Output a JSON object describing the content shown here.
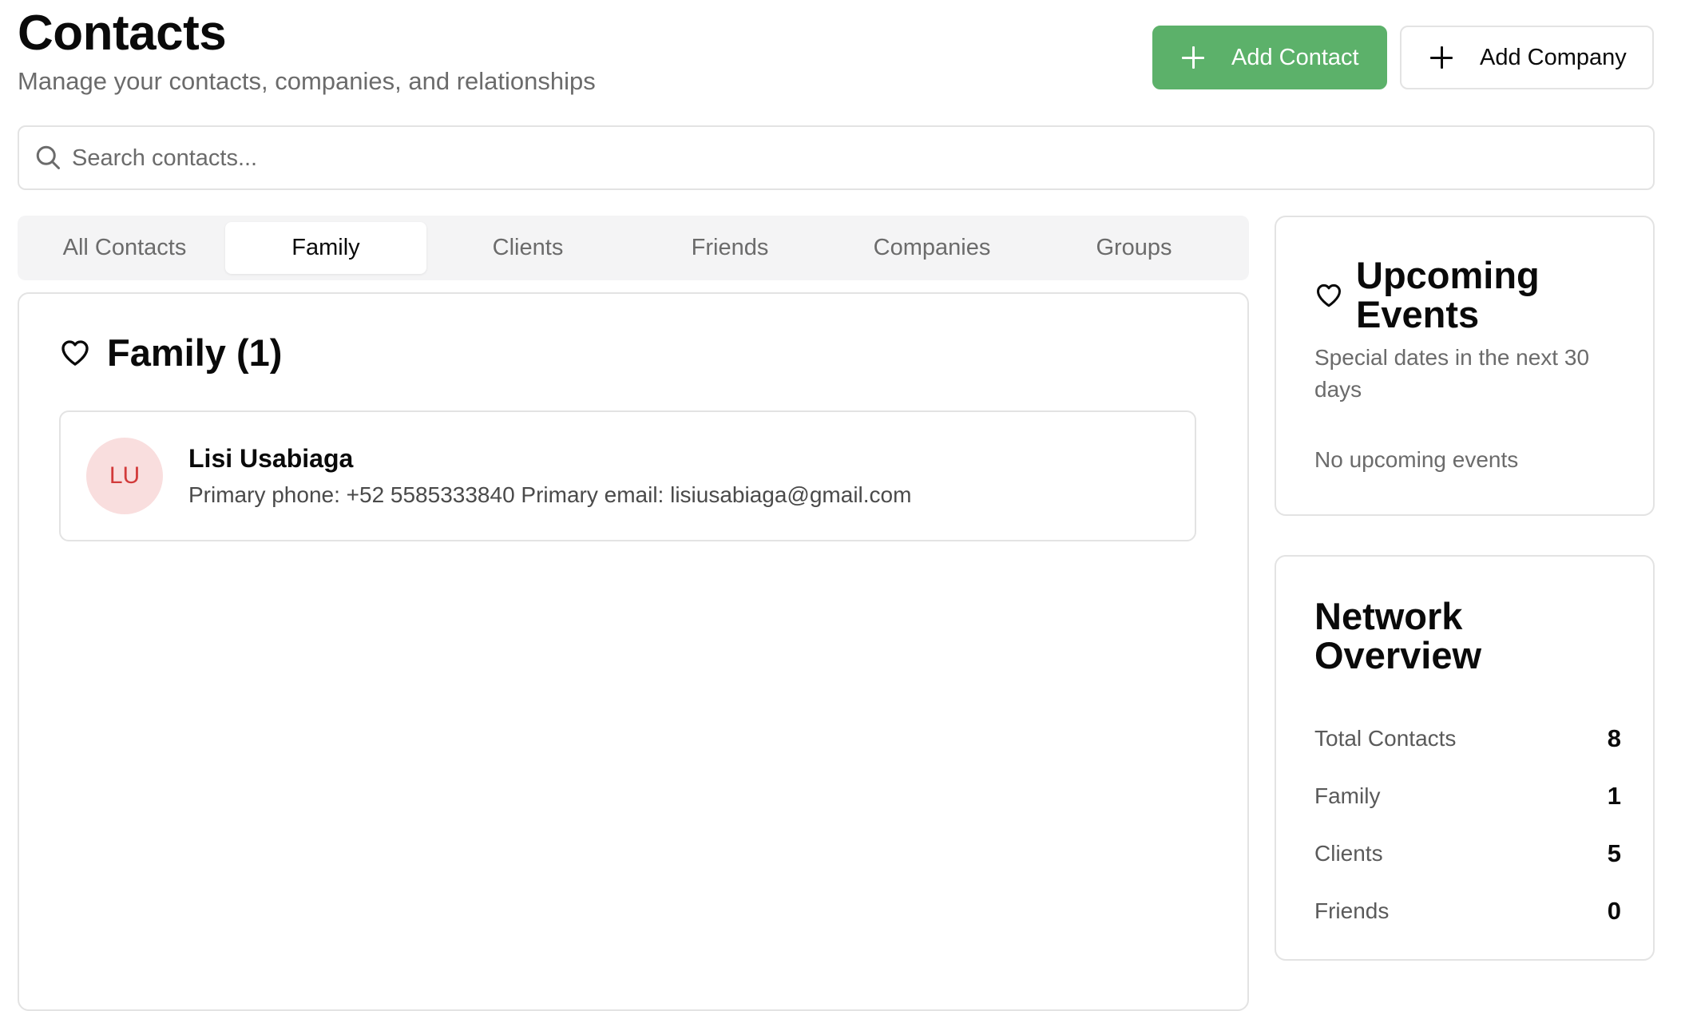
{
  "header": {
    "title": "Contacts",
    "subtitle": "Manage your contacts, companies, and relationships",
    "add_contact_label": "Add Contact",
    "add_company_label": "Add Company"
  },
  "search": {
    "placeholder": "Search contacts...",
    "value": ""
  },
  "tabs": [
    {
      "label": "All Contacts",
      "active": false
    },
    {
      "label": "Family",
      "active": true
    },
    {
      "label": "Clients",
      "active": false
    },
    {
      "label": "Friends",
      "active": false
    },
    {
      "label": "Companies",
      "active": false
    },
    {
      "label": "Groups",
      "active": false
    }
  ],
  "main": {
    "section_title": "Family (1)",
    "contacts": [
      {
        "initials": "LU",
        "name": "Lisi Usabiaga",
        "details": "Primary phone: +52 5585333840 Primary email: lisiusabiaga@gmail.com"
      }
    ]
  },
  "upcoming_events": {
    "title": "Upcoming Events",
    "description": "Special dates in the next 30 days",
    "empty_text": "No upcoming events"
  },
  "network_overview": {
    "title": "Network Overview",
    "stats": [
      {
        "label": "Total Contacts",
        "value": "8"
      },
      {
        "label": "Family",
        "value": "1"
      },
      {
        "label": "Clients",
        "value": "5"
      },
      {
        "label": "Friends",
        "value": "0"
      }
    ]
  },
  "colors": {
    "accent_green": "#5cb16a",
    "avatar_bg": "#f9dede",
    "avatar_text": "#d23a3a",
    "border": "#e3e3e3",
    "muted_text": "#6b6b6b"
  }
}
